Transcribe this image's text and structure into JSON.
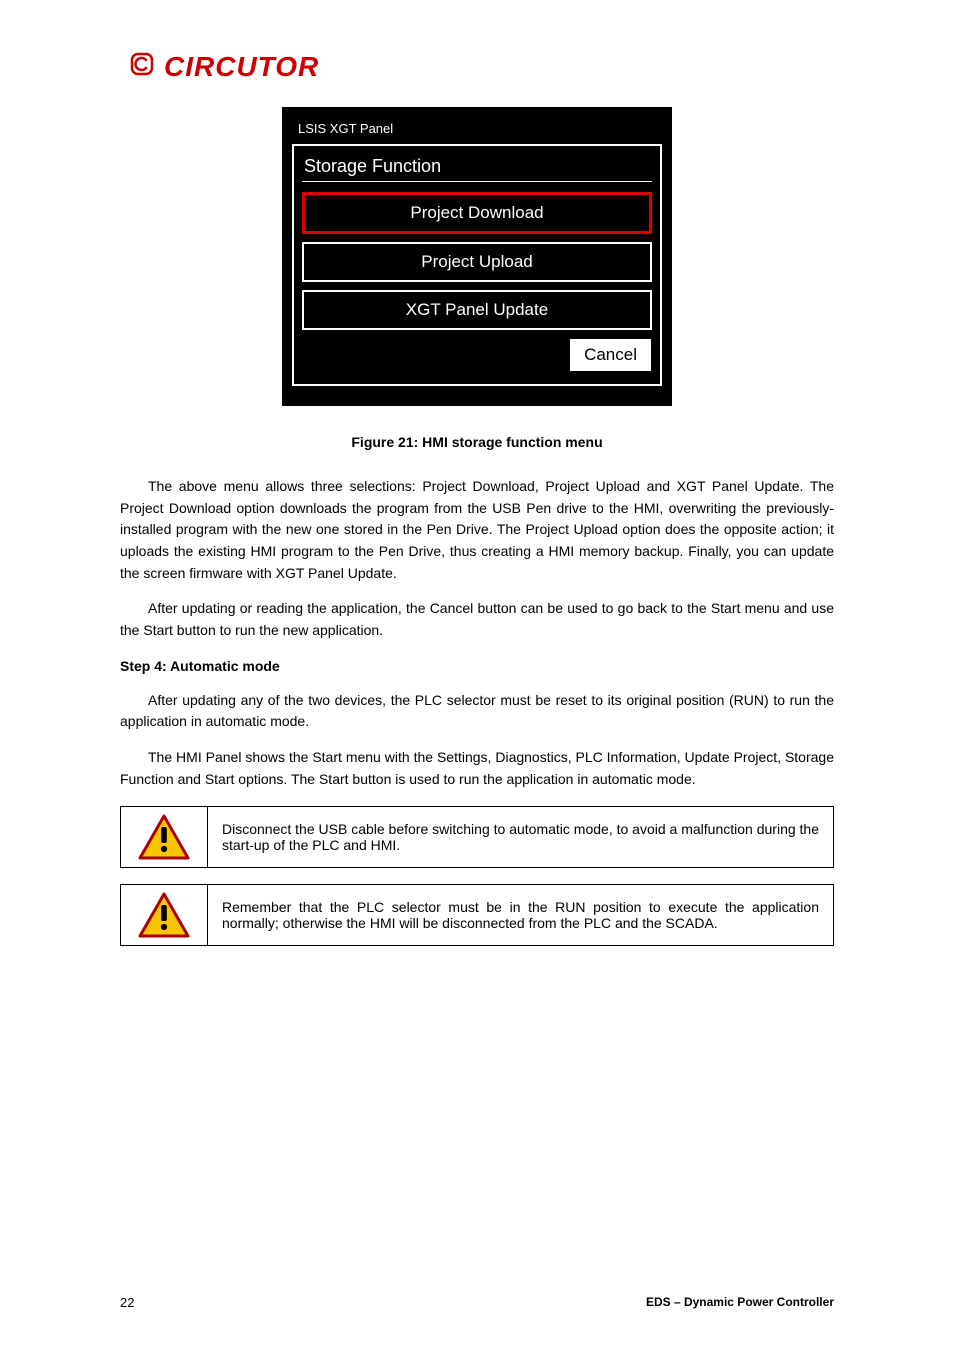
{
  "logo": {
    "brand": "CIRCUTOR",
    "icon": "circutor-c-icon"
  },
  "hmi": {
    "panel_title": "LSIS XGT Panel",
    "section_title": "Storage Function",
    "buttons": {
      "download": "Project Download",
      "upload": "Project Upload",
      "update": "XGT Panel Update"
    },
    "cancel": "Cancel"
  },
  "figure_caption": "Figure 21: HMI storage function menu",
  "body": {
    "p1": "The above menu allows three selections: Project Download, Project Upload and XGT Panel Update. The Project Download option downloads the program from the USB Pen drive to the HMI, overwriting the previously-installed program with the new one stored in the Pen Drive. The Project Upload option does the opposite action; it uploads the existing HMI program to the Pen Drive, thus creating a HMI memory backup. Finally, you can update the screen firmware with XGT Panel Update.",
    "p2": "After updating or reading the application, the Cancel button can be used to go back to the Start menu and use the Start button to run the new application."
  },
  "step4": {
    "title": "Step 4: Automatic mode",
    "p1": "After updating any of the two devices, the PLC selector must be reset to its original position (RUN) to run the application in automatic mode.",
    "p2": "The HMI Panel shows the Start menu with the Settings, Diagnostics, PLC Information, Update Project, Storage Function and Start options. The Start button is used to run the application in automatic mode."
  },
  "warnings": {
    "w1": "Disconnect the USB cable before switching to automatic mode, to avoid a malfunction during the start-up of the PLC and HMI.",
    "w2": "Remember that the PLC selector must be in the RUN position to execute the application normally; otherwise the HMI will be disconnected from the PLC and the SCADA."
  },
  "footer": {
    "page": "22",
    "doc_ref": "EDS – Dynamic Power Controller"
  }
}
